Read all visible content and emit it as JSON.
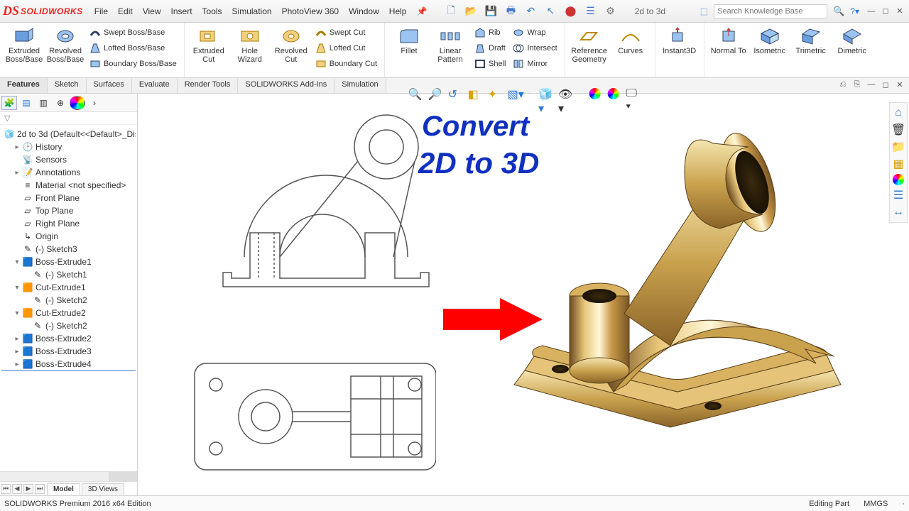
{
  "app": {
    "logo_prefix": "DS",
    "logo_text": "SOLIDWORKS"
  },
  "menus": [
    "File",
    "Edit",
    "View",
    "Insert",
    "Tools",
    "Simulation",
    "PhotoView 360",
    "Window",
    "Help"
  ],
  "docname": "2d to 3d",
  "search_placeholder": "Search Knowledge Base",
  "ribbon": {
    "group1_big": [
      "Extruded Boss/Base",
      "Revolved Boss/Base"
    ],
    "group1_small": [
      "Swept Boss/Base",
      "Lofted Boss/Base",
      "Boundary Boss/Base"
    ],
    "group2_big": [
      "Extruded Cut",
      "Hole Wizard",
      "Revolved Cut"
    ],
    "group2_small": [
      "Swept Cut",
      "Lofted Cut",
      "Boundary Cut"
    ],
    "group3_big": [
      "Fillet",
      "Linear Pattern"
    ],
    "group3_small": [
      "Rib",
      "Draft",
      "Shell"
    ],
    "group3_small2": [
      "Wrap",
      "Intersect",
      "Mirror"
    ],
    "group4_big": [
      "Reference Geometry",
      "Curves"
    ],
    "group5_big": [
      "Instant3D"
    ],
    "group6_big": [
      "Normal To",
      "Isometric",
      "Trimetric",
      "Dimetric"
    ]
  },
  "ribtabs": [
    "Features",
    "Sketch",
    "Surfaces",
    "Evaluate",
    "Render Tools",
    "SOLIDWORKS Add-Ins",
    "Simulation"
  ],
  "ribtab_active": "Features",
  "tree": {
    "root": "2d to 3d  (Default<<Default>_Dis",
    "nodes": [
      {
        "t": "History",
        "tw": "▸",
        "ico": "hist"
      },
      {
        "t": "Sensors",
        "ico": "sens"
      },
      {
        "t": "Annotations",
        "tw": "▸",
        "ico": "anno"
      },
      {
        "t": "Material <not specified>",
        "ico": "mat"
      },
      {
        "t": "Front Plane",
        "ico": "plane"
      },
      {
        "t": "Top Plane",
        "ico": "plane"
      },
      {
        "t": "Right Plane",
        "ico": "plane"
      },
      {
        "t": "Origin",
        "ico": "orig"
      },
      {
        "t": "(-) Sketch3",
        "ico": "sketch"
      },
      {
        "t": "Boss-Extrude1",
        "tw": "▾",
        "ico": "extr"
      },
      {
        "t": "(-) Sketch1",
        "ico": "sketch",
        "ind": 2
      },
      {
        "t": "Cut-Extrude1",
        "tw": "▾",
        "ico": "cut"
      },
      {
        "t": "(-) Sketch2",
        "ico": "sketch",
        "ind": 2
      },
      {
        "t": "Cut-Extrude2",
        "tw": "▾",
        "ico": "cut"
      },
      {
        "t": "(-) Sketch2",
        "ico": "sketch",
        "ind": 2
      },
      {
        "t": "Boss-Extrude2",
        "tw": "▸",
        "ico": "extr"
      },
      {
        "t": "Boss-Extrude3",
        "tw": "▸",
        "ico": "extr"
      },
      {
        "t": "Boss-Extrude4",
        "tw": "▸",
        "ico": "extr",
        "sel": true
      }
    ]
  },
  "bottom_tabs": [
    "Model",
    "3D Views"
  ],
  "bottom_tab_active": "Model",
  "overlay": {
    "line1": "Convert",
    "line2": "2D to 3D"
  },
  "status": {
    "left": "SOLIDWORKS Premium 2016 x64 Edition",
    "right1": "Editing Part",
    "right2": "MMGS"
  }
}
